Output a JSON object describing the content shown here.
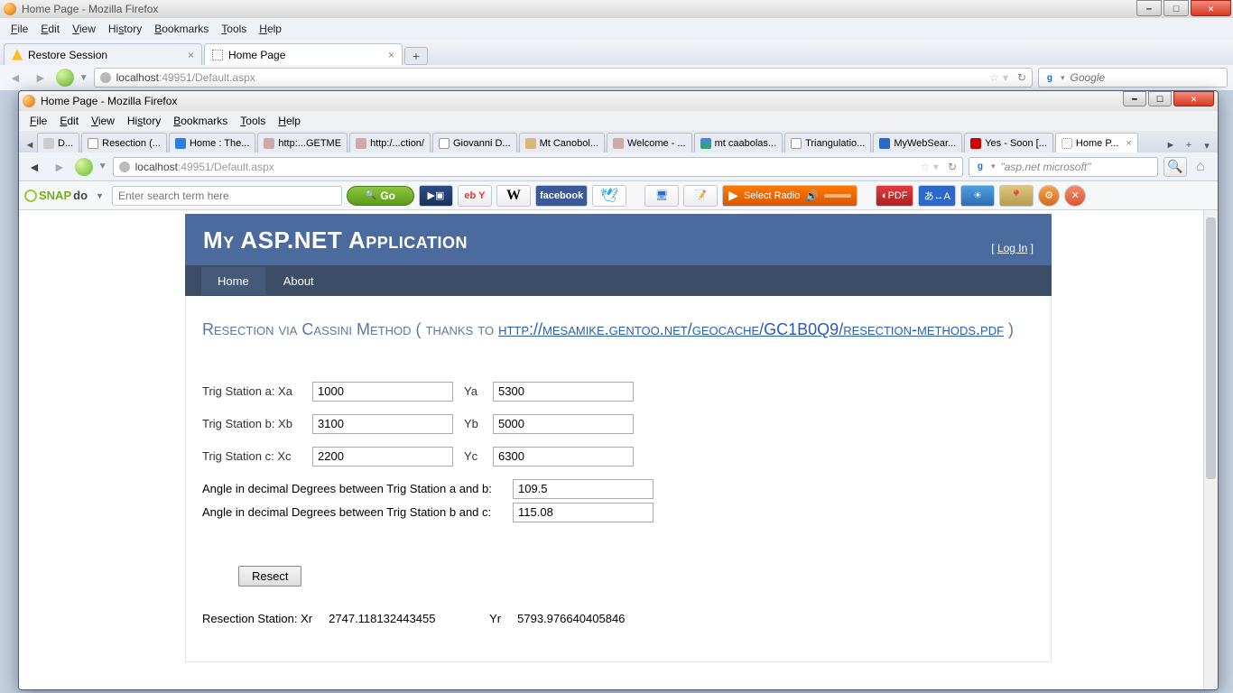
{
  "outer": {
    "title": "Home Page - Mozilla Firefox",
    "menu": [
      "File",
      "Edit",
      "View",
      "History",
      "Bookmarks",
      "Tools",
      "Help"
    ],
    "tabs": [
      {
        "label": "Restore Session",
        "kind": "warn"
      },
      {
        "label": "Home Page",
        "kind": "page",
        "active": true
      }
    ],
    "url_host": "localhost",
    "url_port": ":49951",
    "url_path": "/Default.aspx",
    "search_placeholder": "Google"
  },
  "inner": {
    "title": "Home Page - Mozilla Firefox",
    "menu": [
      "File",
      "Edit",
      "View",
      "History",
      "Bookmarks",
      "Tools",
      "Help"
    ],
    "tabs": [
      "D...",
      "Resection (...",
      "Home : The...",
      "http:...GETME",
      "http:/...ction/",
      "Giovanni D...",
      "Mt Canobol...",
      "Welcome - ...",
      "mt caabolas...",
      "Triangulatio...",
      "MyWebSear...",
      "Yes - Soon [...",
      "Home P..."
    ],
    "tabs_active_index": 12,
    "url_host": "localhost",
    "url_port": ":49951",
    "url_path": "/Default.aspx",
    "search_value": "\"asp.net microsoft\"",
    "snap_placeholder": "Enter search term here",
    "go_label": "Go",
    "radio_label": "Select Radio",
    "fb_label": "facebook",
    "ebay_label": "eb Y",
    "wiki_label": "W",
    "pdf_label": "PDF",
    "jp_label": "あ↔A"
  },
  "app": {
    "title": "My ASP.NET Application",
    "login_label": "Log In",
    "nav": {
      "home": "Home",
      "about": "About"
    },
    "heading_pre": "Resection via Cassini Method ( thanks to ",
    "heading_link": "http://mesamike.gentoo.net/geocache/GC1B0Q9/resection-methods.pdf",
    "heading_post": " )",
    "labels": {
      "xa": "Trig Station a: Xa",
      "ya": "Ya",
      "xb": "Trig Station b: Xb",
      "yb": "Yb",
      "xc": "Trig Station c: Xc",
      "yc": "Yc",
      "angle_ab": "Angle in decimal Degrees between Trig Station a and b:",
      "angle_bc": "Angle in decimal Degrees between Trig Station b and c:"
    },
    "values": {
      "xa": "1000",
      "ya": "5300",
      "xb": "3100",
      "yb": "5000",
      "xc": "2200",
      "yc": "6300",
      "angle_ab": "109.5",
      "angle_bc": "115.08"
    },
    "resect_btn": "Resect",
    "result": {
      "label_xr": "Resection Station: Xr",
      "xr": "2747.118132443455",
      "label_yr": "Yr",
      "yr": "5793.976640405846"
    }
  }
}
